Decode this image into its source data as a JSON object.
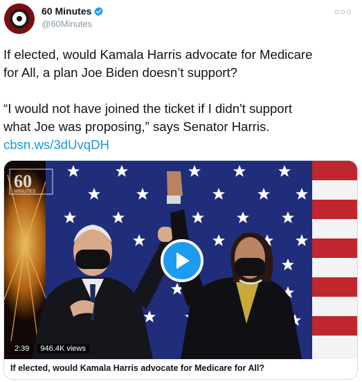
{
  "account": {
    "name": "60 Minutes",
    "handle": "@60Minutes",
    "verified": true,
    "brand_color": "#7a0f12"
  },
  "tweet": {
    "line1": "If elected, would Kamala Harris advocate for Medicare",
    "line2": "for All, a plan Joe Biden doesn’t support?",
    "line3": "“I would not have joined the ticket if I didn't support",
    "line4": "what Joe was proposing,” says Senator Harris.",
    "link": "cbsn.ws/3dUvqDH",
    "link_color": "#1b95e0"
  },
  "media": {
    "logo_text": "60",
    "logo_subtext": "MINUTES",
    "duration": "2:39",
    "views": "946.4K views",
    "play_icon": "play-icon",
    "accent": "#1d9bf0"
  },
  "card": {
    "title": "If elected, would Kamala Harris advocate for Medicare for All?"
  },
  "icons": {
    "more": "more-icon",
    "verified": "verified-badge-icon"
  }
}
